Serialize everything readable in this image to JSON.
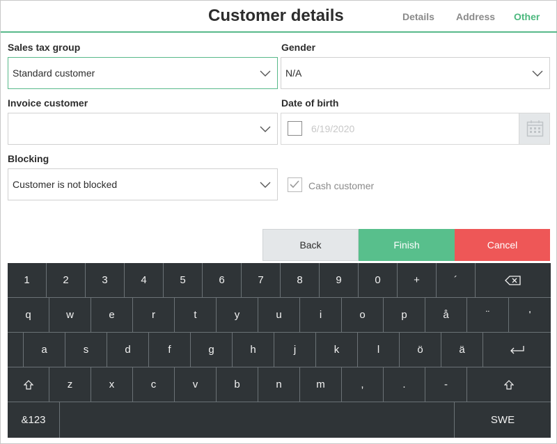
{
  "header": {
    "title": "Customer details",
    "tabs": [
      {
        "label": "Details",
        "active": false
      },
      {
        "label": "Address",
        "active": false
      },
      {
        "label": "Other",
        "active": true
      }
    ]
  },
  "form": {
    "sales_tax_group": {
      "label": "Sales tax group",
      "value": "Standard customer"
    },
    "gender": {
      "label": "Gender",
      "value": "N/A"
    },
    "invoice_customer": {
      "label": "Invoice customer",
      "value": ""
    },
    "date_of_birth": {
      "label": "Date of birth",
      "value": "6/19/2020",
      "checked": false
    },
    "blocking": {
      "label": "Blocking",
      "value": "Customer is not blocked"
    },
    "cash_customer": {
      "label": "Cash customer",
      "checked": true,
      "disabled": true
    }
  },
  "actions": {
    "back": "Back",
    "finish": "Finish",
    "cancel": "Cancel"
  },
  "keyboard": {
    "row1": [
      "1",
      "2",
      "3",
      "4",
      "5",
      "6",
      "7",
      "8",
      "9",
      "0",
      "+",
      "´"
    ],
    "row2": [
      "q",
      "w",
      "e",
      "r",
      "t",
      "y",
      "u",
      "i",
      "o",
      "p",
      "å",
      "¨",
      "'"
    ],
    "row3": [
      "a",
      "s",
      "d",
      "f",
      "g",
      "h",
      "j",
      "k",
      "l",
      "ö",
      "ä"
    ],
    "row4": [
      "z",
      "x",
      "c",
      "v",
      "b",
      "n",
      "m",
      ",",
      ".",
      "-"
    ],
    "symbols_label": "&123",
    "language_label": "SWE"
  },
  "colors": {
    "accent": "#58b98a",
    "finish": "#58bf8c",
    "cancel": "#ee5757",
    "keyboard": "#2f3437"
  }
}
